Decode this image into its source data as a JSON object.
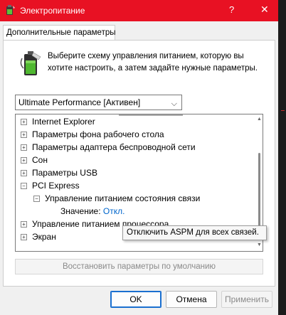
{
  "window": {
    "title": "Электропитание",
    "help_glyph": "?",
    "close_glyph": "✕",
    "accent": "#e81123"
  },
  "tab": {
    "label": "Дополнительные параметры"
  },
  "description": "Выберите схему управления питанием, которую вы хотите настроить, а затем задайте нужные параметры.",
  "plan_select": {
    "value": "Ultimate Performance [Активен]"
  },
  "tree": {
    "items": [
      {
        "label": "Internet Explorer",
        "toggle": "+"
      },
      {
        "label": "Параметры фона рабочего стола",
        "toggle": "+"
      },
      {
        "label": "Параметры адаптера беспроводной сети",
        "toggle": "+"
      },
      {
        "label": "Сон",
        "toggle": "+"
      },
      {
        "label": "Параметры USB",
        "toggle": "+"
      },
      {
        "label": "PCI Express",
        "toggle": "−"
      },
      {
        "label": "Управление питанием состояния связи",
        "toggle": "−"
      },
      {
        "label": "Значение:",
        "value": "Откл."
      },
      {
        "label": "Управление питанием процессора",
        "toggle": "+"
      },
      {
        "label": "Экран",
        "toggle": "+"
      }
    ]
  },
  "tooltip": "Отключить ASPM для всех связей.",
  "restore_button": "Восстановить параметры по умолчанию",
  "buttons": {
    "ok": "OK",
    "cancel": "Отмена",
    "apply": "Применить"
  }
}
